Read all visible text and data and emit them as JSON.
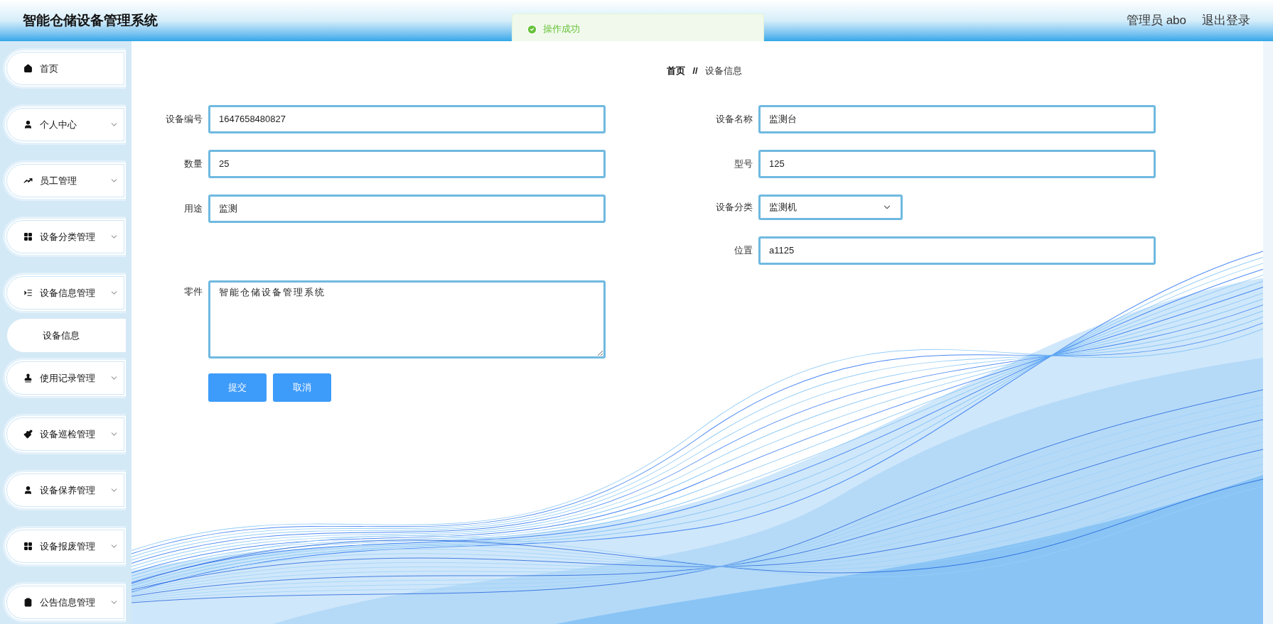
{
  "header": {
    "title": "智能仓储设备管理系统",
    "user": "管理员 abo",
    "logout": "退出登录"
  },
  "toast": {
    "message": "操作成功"
  },
  "sidebar": {
    "items": [
      {
        "label": "首页",
        "expandable": false
      },
      {
        "label": "个人中心",
        "expandable": true
      },
      {
        "label": "员工管理",
        "expandable": true
      },
      {
        "label": "设备分类管理",
        "expandable": true
      },
      {
        "label": "设备信息管理",
        "expandable": true,
        "children": [
          {
            "label": "设备信息"
          }
        ]
      },
      {
        "label": "使用记录管理",
        "expandable": true
      },
      {
        "label": "设备巡检管理",
        "expandable": true
      },
      {
        "label": "设备保养管理",
        "expandable": true
      },
      {
        "label": "设备报废管理",
        "expandable": true
      },
      {
        "label": "公告信息管理",
        "expandable": true
      }
    ]
  },
  "breadcrumb": {
    "separator": "//",
    "items": [
      "首页",
      "设备信息"
    ]
  },
  "form": {
    "left": [
      {
        "label": "设备编号",
        "value": "1647658480827",
        "kind": "input"
      },
      {
        "label": "数量",
        "value": "25",
        "kind": "input"
      },
      {
        "label": "用途",
        "value": "监测",
        "kind": "input"
      },
      {
        "label": "零件",
        "value": "智能仓储设备管理系统",
        "kind": "textarea"
      }
    ],
    "right": [
      {
        "label": "设备名称",
        "value": "监测台",
        "kind": "input"
      },
      {
        "label": "型号",
        "value": "125",
        "kind": "input"
      },
      {
        "label": "设备分类",
        "value": "监测机",
        "kind": "select"
      },
      {
        "label": "位置",
        "value": "a1125",
        "kind": "input"
      }
    ],
    "buttons": [
      "提交",
      "取消"
    ]
  }
}
